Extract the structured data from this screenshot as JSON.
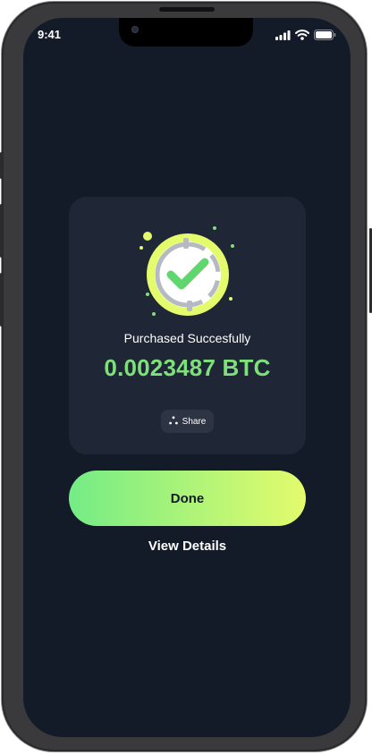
{
  "status_bar": {
    "time": "9:41"
  },
  "success_card": {
    "title": "Purchased Succesfully",
    "amount": "0.0023487 BTC",
    "share_label": "Share"
  },
  "actions": {
    "done_label": "Done",
    "view_details_label": "View Details"
  },
  "theme": {
    "background": "#131a28",
    "card": "#1f2635",
    "accent_green": "#7ee07a",
    "accent_lime": "#e4fb6c"
  },
  "icons": {
    "success": "check-coin-icon",
    "share": "share-icon",
    "signal": "signal-icon",
    "wifi": "wifi-icon",
    "battery": "battery-icon"
  }
}
